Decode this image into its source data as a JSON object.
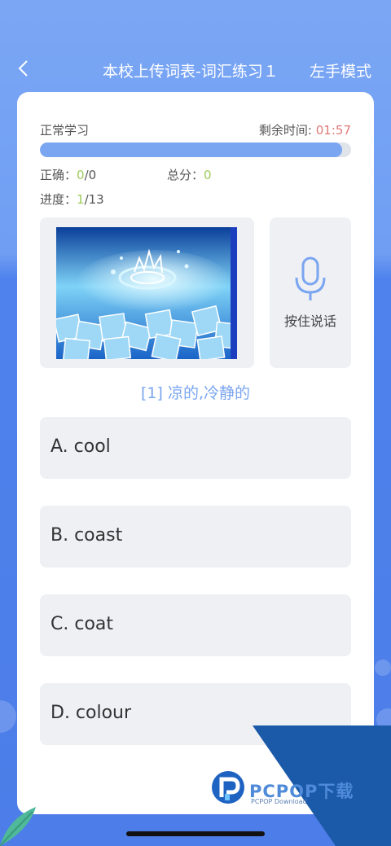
{
  "header": {
    "back_icon": "chevron-left-icon",
    "title": "本校上传词表-词汇练习１",
    "mode_label": "左手模式"
  },
  "session": {
    "status_label": "正常学习",
    "timer_label": "剩余时间:",
    "timer_value": "01:57",
    "progress_fraction": 0.97,
    "correct_label": "正确：",
    "correct_value": "0",
    "correct_total": "/0",
    "score_label": "总分：",
    "score_value": "0",
    "progress_label": "进度：",
    "progress_current": "1",
    "progress_total": "/13"
  },
  "media": {
    "image": "ice-water-splash-image",
    "mic_icon": "microphone-icon",
    "mic_label": "按住说话"
  },
  "question": {
    "prompt": "[1] 凉的,冷静的"
  },
  "options": [
    {
      "label": "A. cool"
    },
    {
      "label": "B. coast"
    },
    {
      "label": "C. coat"
    },
    {
      "label": "D. colour"
    }
  ],
  "watermark": {
    "brand": "PCPOP下载",
    "sub": "PCPOP Download",
    "accent": "#1b5aa8"
  },
  "colors": {
    "accent_blue": "#7aa5f0",
    "timer_red": "#e07a7a",
    "number_green": "#9ccc5a"
  }
}
